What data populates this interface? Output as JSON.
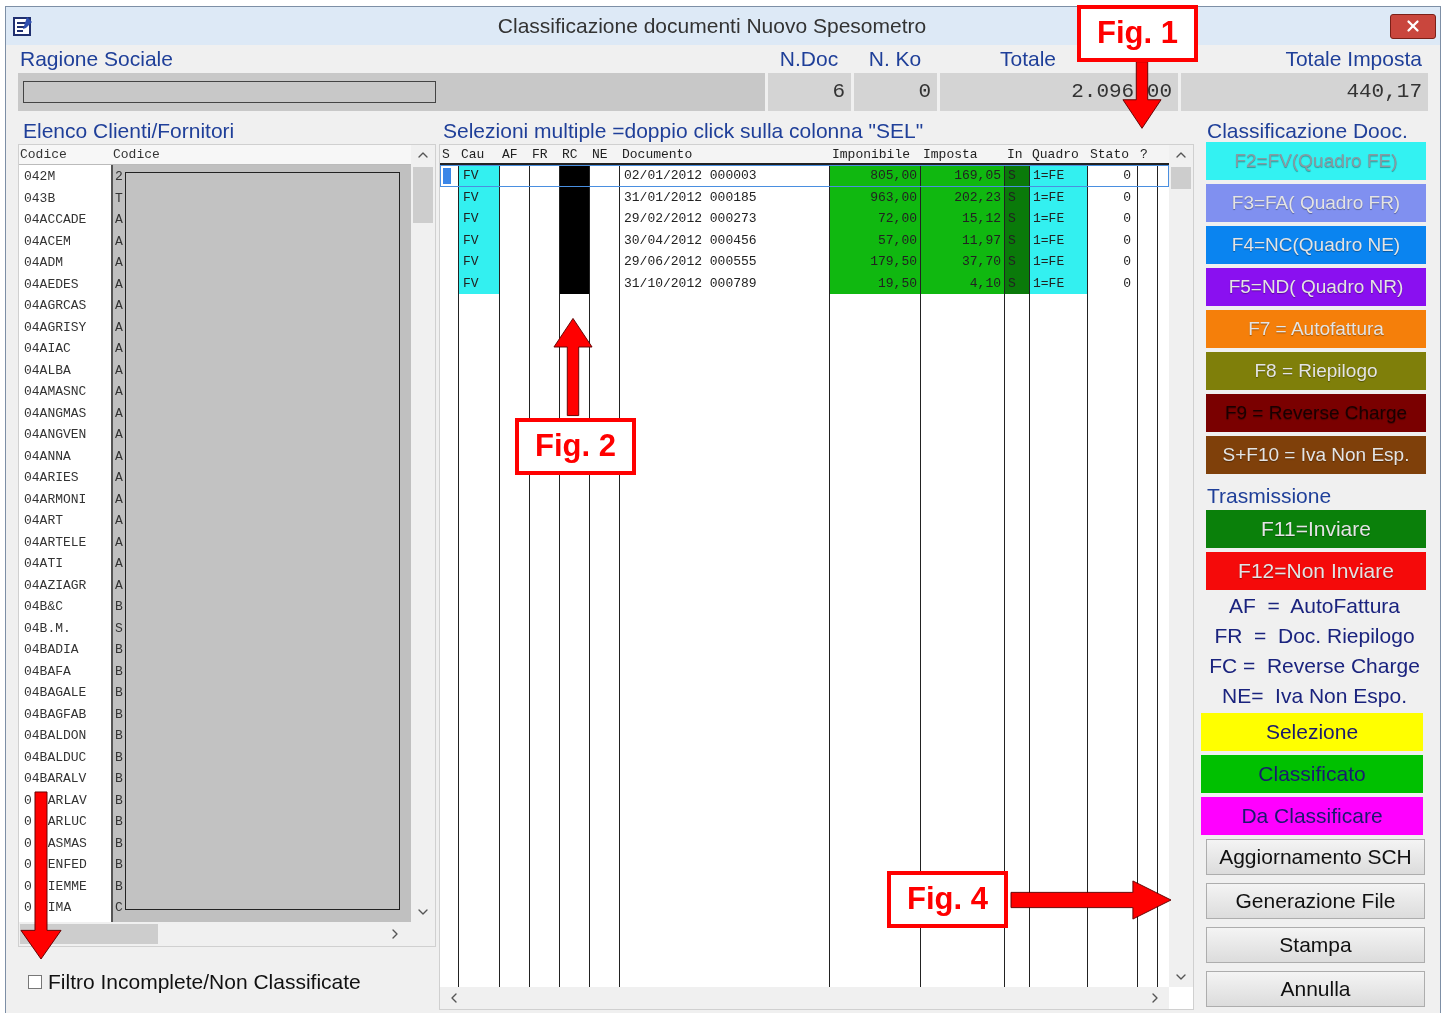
{
  "window": {
    "title": "Classificazione documenti Nuovo Spesometro"
  },
  "summary": {
    "label": "Ragione Sociale",
    "columns": [
      {
        "label": "N.Doc",
        "value": "6"
      },
      {
        "label": "N. Ko",
        "value": "0"
      },
      {
        "label": "Totale",
        "value": "2.096,00"
      },
      {
        "label": "Totale Imposta",
        "value": "440,17"
      }
    ]
  },
  "clients": {
    "title": "Elenco Clienti/Fornitori",
    "columns": [
      "Codice",
      "Codice"
    ],
    "rows": [
      {
        "code": "042M",
        "name": "2"
      },
      {
        "code": "043B",
        "name": "T"
      },
      {
        "code": "04ACCADE",
        "name": "A"
      },
      {
        "code": "04ACEM",
        "name": "A"
      },
      {
        "code": "04ADM",
        "name": "A"
      },
      {
        "code": "04AEDES",
        "name": "A"
      },
      {
        "code": "04AGRCAS",
        "name": "A"
      },
      {
        "code": "04AGRISY",
        "name": "A"
      },
      {
        "code": "04AIAC",
        "name": "A"
      },
      {
        "code": "04ALBA",
        "name": "A"
      },
      {
        "code": "04AMASNC",
        "name": "A"
      },
      {
        "code": "04ANGMAS",
        "name": "A"
      },
      {
        "code": "04ANGVEN",
        "name": "A"
      },
      {
        "code": "04ANNA",
        "name": "A"
      },
      {
        "code": "04ARIES",
        "name": "A"
      },
      {
        "code": "04ARMONI",
        "name": "A"
      },
      {
        "code": "04ART",
        "name": "A"
      },
      {
        "code": "04ARTELE",
        "name": "A"
      },
      {
        "code": "04ATI",
        "name": "A"
      },
      {
        "code": "04AZIAGR",
        "name": "A"
      },
      {
        "code": "04B&C",
        "name": "B"
      },
      {
        "code": "04B.M.",
        "name": "S"
      },
      {
        "code": "04BADIA",
        "name": "B"
      },
      {
        "code": "04BAFA",
        "name": "B"
      },
      {
        "code": "04BAGALE",
        "name": "B"
      },
      {
        "code": "04BAGFAB",
        "name": "B"
      },
      {
        "code": "04BALDON",
        "name": "B"
      },
      {
        "code": "04BALDUC",
        "name": "B"
      },
      {
        "code": "04BARALV",
        "name": "B"
      },
      {
        "code": "0",
        "code_tail": "ARLAV",
        "name": "B"
      },
      {
        "code": "0",
        "code_tail": "ARLUC",
        "name": "B"
      },
      {
        "code": "0",
        "code_tail": "ASMAS",
        "name": "B"
      },
      {
        "code": "0",
        "code_tail": "ENFED",
        "name": "B"
      },
      {
        "code": "0",
        "code_tail": "IEMME",
        "name": "B"
      },
      {
        "code": "0",
        "code_tail": "IMA",
        "name": "C"
      }
    ]
  },
  "filter": {
    "label": "Filtro Incomplete/Non Classificate",
    "checked": false
  },
  "documents": {
    "title": "Selezioni multiple =doppio click sulla colonna \"SEL\"",
    "columns": [
      "S",
      "Cau",
      "AF",
      "FR",
      "RC",
      "NE",
      "Documento",
      "Imponibile",
      "Imposta",
      "In",
      "Quadro",
      "Stato",
      "?"
    ],
    "rows": [
      {
        "selected": true,
        "cau": "FV",
        "documento": "02/01/2012 000003",
        "imponibile": "805,00",
        "imposta": "169,05",
        "in": "S",
        "quadro": "1=FE",
        "stato": "0"
      },
      {
        "selected": false,
        "cau": "FV",
        "documento": "31/01/2012 000185",
        "imponibile": "963,00",
        "imposta": "202,23",
        "in": "S",
        "quadro": "1=FE",
        "stato": "0"
      },
      {
        "selected": false,
        "cau": "FV",
        "documento": "29/02/2012 000273",
        "imponibile": "72,00",
        "imposta": "15,12",
        "in": "S",
        "quadro": "1=FE",
        "stato": "0"
      },
      {
        "selected": false,
        "cau": "FV",
        "documento": "30/04/2012 000456",
        "imponibile": "57,00",
        "imposta": "11,97",
        "in": "S",
        "quadro": "1=FE",
        "stato": "0"
      },
      {
        "selected": false,
        "cau": "FV",
        "documento": "29/06/2012 000555",
        "imponibile": "179,50",
        "imposta": "37,70",
        "in": "S",
        "quadro": "1=FE",
        "stato": "0"
      },
      {
        "selected": false,
        "cau": "FV",
        "documento": "31/10/2012 000789",
        "imponibile": "19,50",
        "imposta": "4,10",
        "in": "S",
        "quadro": "1=FE",
        "stato": "0"
      }
    ]
  },
  "classification": {
    "title": "Classificazione Dooc.",
    "buttons": [
      {
        "label": "F2=FV(Quadro FE)",
        "color": "#33f2f2"
      },
      {
        "label": "F3=FA( Quadro FR)",
        "color": "#8090f0"
      },
      {
        "label": "F4=NC(Quadro NE)",
        "color": "#0a84f0"
      },
      {
        "label": "F5=ND( Quadro NR)",
        "color": "#8a10f0"
      },
      {
        "label": "F7 = Autofattura",
        "color": "#f57f0a"
      },
      {
        "label": "F8 = Riepilogo",
        "color": "#7f7f0a"
      },
      {
        "label": "F9 = Reverse Charge",
        "color": "#7a0000"
      },
      {
        "label": "S+F10 = Iva Non Esp.",
        "color": "#7f400a"
      }
    ]
  },
  "transmission": {
    "title": "Trasmissione",
    "buttons": [
      {
        "label": "F11=Inviare",
        "color": "#0a800a"
      },
      {
        "label": "F12=Non Inviare",
        "color": "#f50a0a"
      }
    ]
  },
  "legend": [
    "AF  =  AutoFattura",
    "FR  =  Doc. Riepilogo",
    "FC =  Reverse Charge",
    "NE=  Iva Non Espo."
  ],
  "status": [
    {
      "label": "Selezione",
      "color": "#ffff00"
    },
    {
      "label": "Classificato",
      "color": "#00c000"
    },
    {
      "label": "Da Classificare",
      "color": "#ff00ff"
    }
  ],
  "actions": [
    "Aggiornamento SCH",
    "Generazione File",
    "Stampa",
    "Annulla"
  ],
  "annotations": [
    {
      "label": "Fig. 1",
      "kind": "down"
    },
    {
      "label": "Fig. 2",
      "kind": "up"
    },
    {
      "label": "Fig. 4",
      "kind": "right"
    },
    {
      "kind": "down"
    }
  ]
}
